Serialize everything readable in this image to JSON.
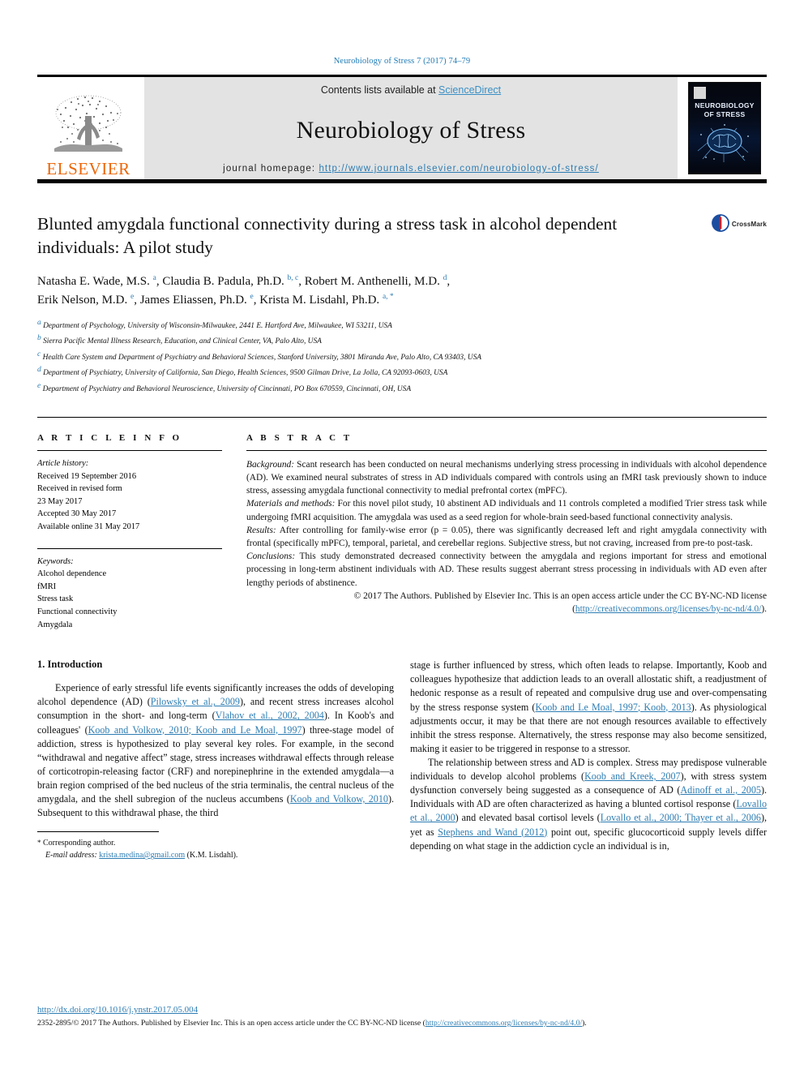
{
  "running_head": "Neurobiology of Stress 7 (2017) 74–79",
  "banner": {
    "publisher_name": "ELSEVIER",
    "contents_prefix": "Contents lists available at ",
    "contents_link": "ScienceDirect",
    "journal_name": "Neurobiology of Stress",
    "homepage_label": "journal homepage: ",
    "homepage_url": "http://www.journals.elsevier.com/neurobiology-of-stress/",
    "cover_title_line1": "NEUROBIOLOGY",
    "cover_title_line2": "OF STRESS"
  },
  "article": {
    "title": "Blunted amygdala functional connectivity during a stress task in alcohol dependent individuals: A pilot study",
    "crossmark_label": "CrossMark",
    "authors_line1": "Natasha E. Wade, M.S. a, Claudia B. Padula, Ph.D. b, c, Robert M. Anthenelli, M.D. d,",
    "authors_line2": "Erik Nelson, M.D. e, James Eliassen, Ph.D. e, Krista M. Lisdahl, Ph.D. a, *",
    "affiliations": [
      {
        "marker": "a",
        "text": "Department of Psychology, University of Wisconsin-Milwaukee, 2441 E. Hartford Ave, Milwaukee, WI 53211, USA"
      },
      {
        "marker": "b",
        "text": "Sierra Pacific Mental Illness Research, Education, and Clinical Center, VA, Palo Alto, USA"
      },
      {
        "marker": "c",
        "text": "Health Care System and Department of Psychiatry and Behavioral Sciences, Stanford University, 3801 Miranda Ave, Palo Alto, CA 93403, USA"
      },
      {
        "marker": "d",
        "text": "Department of Psychiatry, University of California, San Diego, Health Sciences, 9500 Gilman Drive, La Jolla, CA 92093-0603, USA"
      },
      {
        "marker": "e",
        "text": "Department of Psychiatry and Behavioral Neuroscience, University of Cincinnati, PO Box 670559, Cincinnati, OH, USA"
      }
    ]
  },
  "article_info": {
    "heading": "A R T I C L E  I N F O",
    "history_label": "Article history:",
    "history_lines": [
      "Received 19 September 2016",
      "Received in revised form",
      "23 May 2017",
      "Accepted 30 May 2017",
      "Available online 31 May 2017"
    ],
    "keywords_label": "Keywords:",
    "keywords": [
      "Alcohol dependence",
      "fMRI",
      "Stress task",
      "Functional connectivity",
      "Amygdala"
    ]
  },
  "abstract": {
    "heading": "A B S T R A C T",
    "background_label": "Background:",
    "background_text": " Scant research has been conducted on neural mechanisms underlying stress processing in individuals with alcohol dependence (AD). We examined neural substrates of stress in AD individuals compared with controls using an fMRI task previously shown to induce stress, assessing amygdala functional connectivity to medial prefrontal cortex (mPFC).",
    "methods_label": "Materials and methods:",
    "methods_text": " For this novel pilot study, 10 abstinent AD individuals and 11 controls completed a modified Trier stress task while undergoing fMRI acquisition. The amygdala was used as a seed region for whole-brain seed-based functional connectivity analysis.",
    "results_label": "Results:",
    "results_text": " After controlling for family-wise error (p = 0.05), there was significantly decreased left and right amygdala connectivity with frontal (specifically mPFC), temporal, parietal, and cerebellar regions. Subjective stress, but not craving, increased from pre-to post-task.",
    "conclusions_label": "Conclusions:",
    "conclusions_text": " This study demonstrated decreased connectivity between the amygdala and regions important for stress and emotional processing in long-term abstinent individuals with AD. These results suggest aberrant stress processing in individuals with AD even after lengthy periods of abstinence.",
    "copyright_text": "© 2017 The Authors. Published by Elsevier Inc. This is an open access article under the CC BY-NC-ND license (",
    "copyright_link": "http://creativecommons.org/licenses/by-nc-nd/4.0/",
    "copyright_tail": ")."
  },
  "body": {
    "section_heading": "1. Introduction",
    "left_p1_a": "Experience of early stressful life events significantly increases the odds of developing alcohol dependence (AD) (",
    "left_p1_c1": "Pilowsky et al., 2009",
    "left_p1_b": "), and recent stress increases alcohol consumption in the short- and long-term (",
    "left_p1_c2": "Vlahov et al., 2002, 2004",
    "left_p1_c": "). In Koob's and colleagues' (",
    "left_p1_c3": "Koob and Volkow, 2010; Koob and Le Moal, 1997",
    "left_p1_d": ") three-stage model of addiction, stress is hypothesized to play several key roles. For example, in the second “withdrawal and negative affect” stage, stress increases withdrawal effects through release of corticotropin-releasing factor (CRF) and norepinephrine in the extended amygdala—a brain region comprised of the bed nucleus of the stria terminalis, the central nucleus of the amygdala, and the shell subregion of the nucleus accumbens (",
    "left_p1_c4": "Koob and Volkow, 2010",
    "left_p1_e": "). Subsequent to this withdrawal phase, the third",
    "right_p1_a": "stage is further influenced by stress, which often leads to relapse. Importantly, Koob and colleagues hypothesize that addiction leads to an overall allostatic shift, a readjustment of hedonic response as a result of repeated and compulsive drug use and over-compensating by the stress response system (",
    "right_p1_c1": "Koob and Le Moal, 1997; Koob, 2013",
    "right_p1_b": "). As physiological adjustments occur, it may be that there are not enough resources available to effectively inhibit the stress response. Alternatively, the stress response may also become sensitized, making it easier to be triggered in response to a stressor.",
    "right_p2_a": "The relationship between stress and AD is complex. Stress may predispose vulnerable individuals to develop alcohol problems (",
    "right_p2_c1": "Koob and Kreek, 2007",
    "right_p2_b": "), with stress system dysfunction conversely being suggested as a consequence of AD (",
    "right_p2_c2": "Adinoff et al., 2005",
    "right_p2_c": "). Individuals with AD are often characterized as having a blunted cortisol response (",
    "right_p2_c3": "Lovallo et al., 2000",
    "right_p2_d": ") and elevated basal cortisol levels (",
    "right_p2_c4": "Lovallo et al., 2000; Thayer et al., 2006",
    "right_p2_e": "), yet as ",
    "right_p2_c5": "Stephens and Wand (2012)",
    "right_p2_f": " point out, specific glucocorticoid supply levels differ depending on what stage in the addiction cycle an individual is in,"
  },
  "footnote": {
    "corresponding_marker": "*",
    "corresponding_text": "Corresponding author.",
    "email_label": "E-mail address:",
    "email": "krista.medina@gmail.com",
    "email_owner": "(K.M. Lisdahl)."
  },
  "page_footer": {
    "doi": "http://dx.doi.org/10.1016/j.ynstr.2017.05.004",
    "issn_text": "2352-2895/© 2017 The Authors. Published by Elsevier Inc. This is an open access article under the CC BY-NC-ND license (",
    "issn_link": "http://creativecommons.org/licenses/by-nc-nd/4.0/",
    "issn_tail": ")."
  },
  "colors": {
    "link": "#2e7db3",
    "elsevier_orange": "#ec6608",
    "banner_bg": "#e3e3e3"
  }
}
